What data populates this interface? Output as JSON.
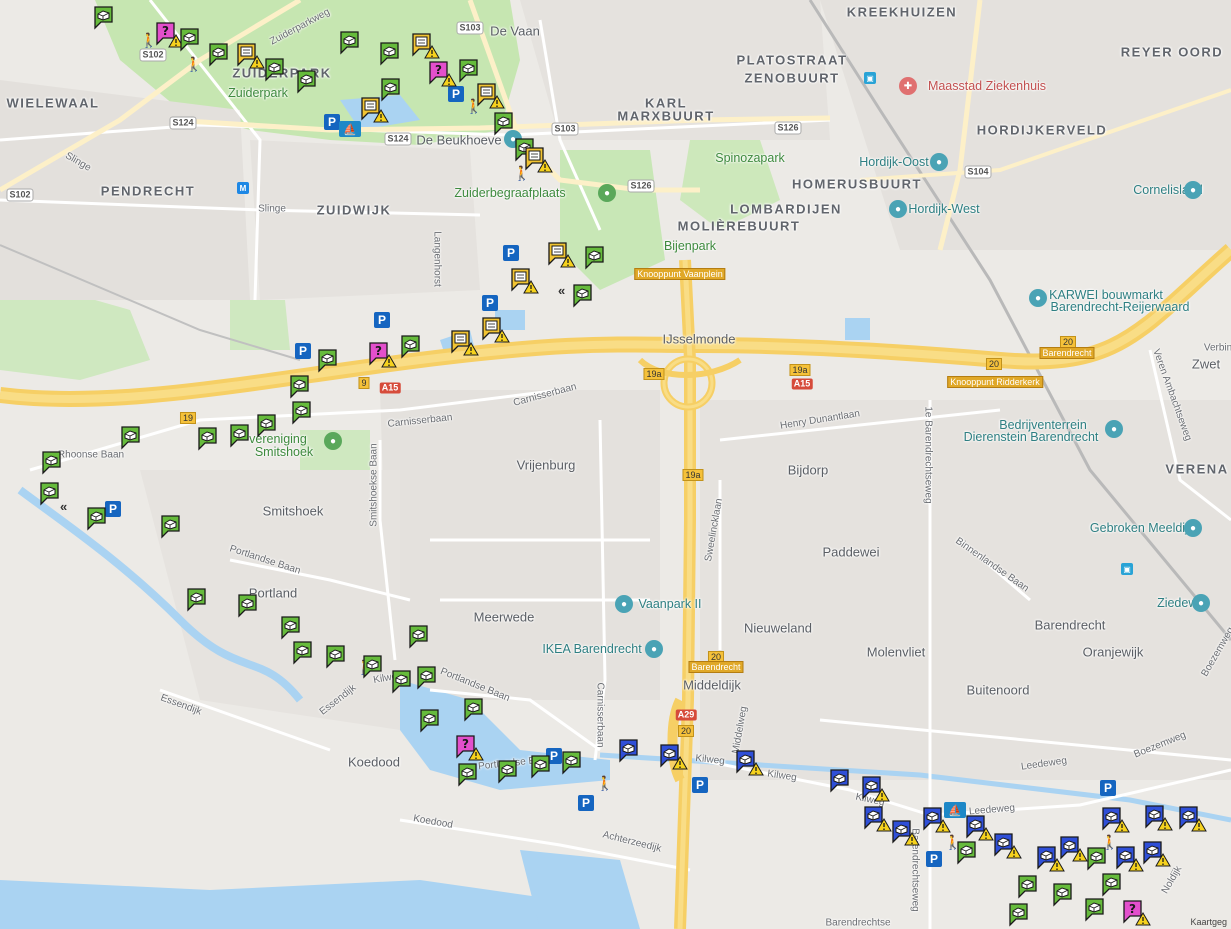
{
  "map": {
    "districts": [
      "KREEKHUIZEN",
      "PLATOSTRAAT",
      "ZENOBUURT",
      "REYER OORD",
      "WIELEWAAL",
      "ZUIDERPARK",
      "KARL",
      "MARXBUURT",
      "HORDIJKERVELD",
      "PENDRECHT",
      "ZUIDWIJK",
      "HOMERUSBUURT",
      "LOMBARDIJEN",
      "MOLIÈREBUURT"
    ],
    "areas": [
      "De Vaan",
      "Zuiderpark",
      "De Beukhoeve",
      "Spinozapark",
      "Hordijk-Oost",
      "Cornelisland",
      "Hordijk-West",
      "Bijenpark",
      "IJsselmonde",
      "KARWEI bouwmarkt",
      "Barendrecht-Reijerwaard",
      "Zwet",
      "Verbin",
      "Bedrijventerrein",
      "Dierenstein Barendrecht",
      "VERENA",
      "Vrijenburg",
      "Bijdorp",
      "Smitshoek",
      "Paddewei",
      "Gebroken Meeldijk",
      "Portland",
      "Meerwede",
      "Vaanpark II",
      "Nieuweland",
      "Barendrecht",
      "Oranjewijk",
      "Ziedewij",
      "IKEA Barendrecht",
      "Molenvliet",
      "Middeldijk",
      "Buitenoord",
      "Koedood",
      "Zuiderbegraafplaats",
      "Maasstad Ziekenhuis",
      "vereniging",
      "Smitshoek",
      "Barendrechtse"
    ],
    "streets": [
      "Zuiderparkweg",
      "Slinge",
      "Slinge",
      "Langenhorst",
      "Carnisserbaan",
      "Henry Dunantlaan",
      "Rhoonse Baan",
      "Smitshoekse Baan",
      "Carnisserbaan",
      "Sweelincklaan",
      "Portlandse Baan",
      "1e Barendrechtseweg",
      "Binnenlandse Baan",
      "Essendijk",
      "Essendijk",
      "Portlandse Baan",
      "Carnisserbaan",
      "Middelweg",
      "Kilweg",
      "Kilweg",
      "Leedeweg",
      "Leedeweg",
      "Boezemweg",
      "Koedood",
      "Achterzeedijk",
      "Noldijk",
      "Veren Ambachtseweg",
      "Boezemweg",
      "Barendrechtseweg",
      "Kilweg",
      "Kilweg",
      "Portlandse Baan"
    ],
    "shields": [
      "S103",
      "S102",
      "S124",
      "S124",
      "S103",
      "S126",
      "S126",
      "S104",
      "S102"
    ],
    "highways": [
      "A15",
      "A15",
      "A29"
    ],
    "junctions": [
      "19",
      "19a",
      "19a",
      "19a",
      "20",
      "20",
      "20",
      "9",
      "20"
    ],
    "knooppunten": [
      "Knooppunt Vaanplein",
      "Knooppunt Ridderkerk",
      "Barendrecht",
      "Barendrecht"
    ],
    "icons": {
      "parking": "P",
      "walk": "🚶",
      "boat": "⛵",
      "metro": "M",
      "hospital": "✚",
      "train": "🚆"
    },
    "footer": "Kaartgeg"
  },
  "colors": {
    "green": "#66bb3c",
    "blue": "#2f4fd8",
    "magenta": "#e34fcc",
    "yellow": "#f2c433",
    "warn": "#f6d21d"
  }
}
